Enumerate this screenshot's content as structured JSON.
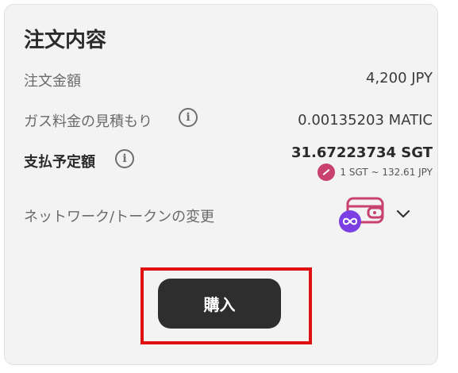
{
  "order": {
    "title": "注文内容",
    "amount_label": "注文金額",
    "amount_value": "4,200 JPY",
    "gas_label": "ガス料金の見積もり",
    "gas_value": "0.00135203 MATIC",
    "payment_label": "支払予定額",
    "payment_value": "31.67223734 SGT",
    "rate_text": "1 SGT ~ 132.61 JPY",
    "network_label": "ネットワーク/トークンの変更",
    "buy_label": "購入"
  },
  "icons": {
    "info": "info-circle-icon",
    "token": "sgt-token-icon",
    "wallet": "wallet-icon",
    "network": "polygon-icon",
    "chevron": "chevron-down-icon"
  },
  "colors": {
    "card_bg": "#f3f3f3",
    "button_bg": "#2e2e2e",
    "highlight_outline": "#e01010",
    "token_pink": "#c8416f",
    "polygon_purple": "#7b3fe4"
  }
}
